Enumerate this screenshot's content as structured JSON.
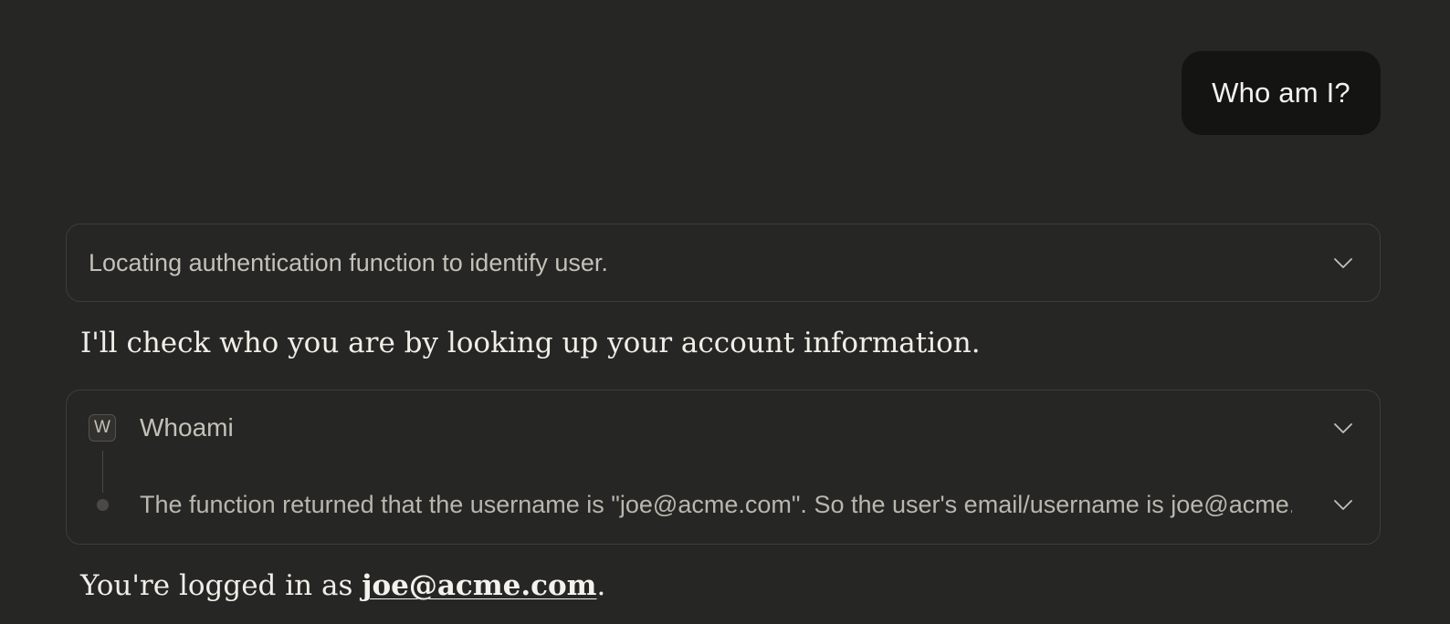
{
  "user_message": {
    "text": "Who am I?"
  },
  "thinking": {
    "summary": "Locating authentication function to identify user.",
    "icon": "chevron-down-icon"
  },
  "assistant": {
    "intro": "I'll check who you are by looking up your account information.",
    "final_prefix": "You're logged in as ",
    "final_email": "joe@acme.com",
    "final_suffix": "."
  },
  "tool_call": {
    "badge": "W",
    "name": "Whoami",
    "result_summary": "The function returned that the username is \"joe@acme.com\". So the user's email/username is joe@acme.com.",
    "icon": "chevron-down-icon"
  },
  "colors": {
    "background": "#262624",
    "user_bubble": "#141413",
    "card_border": "#3d3d3a",
    "muted_text": "#c3c1b8"
  }
}
